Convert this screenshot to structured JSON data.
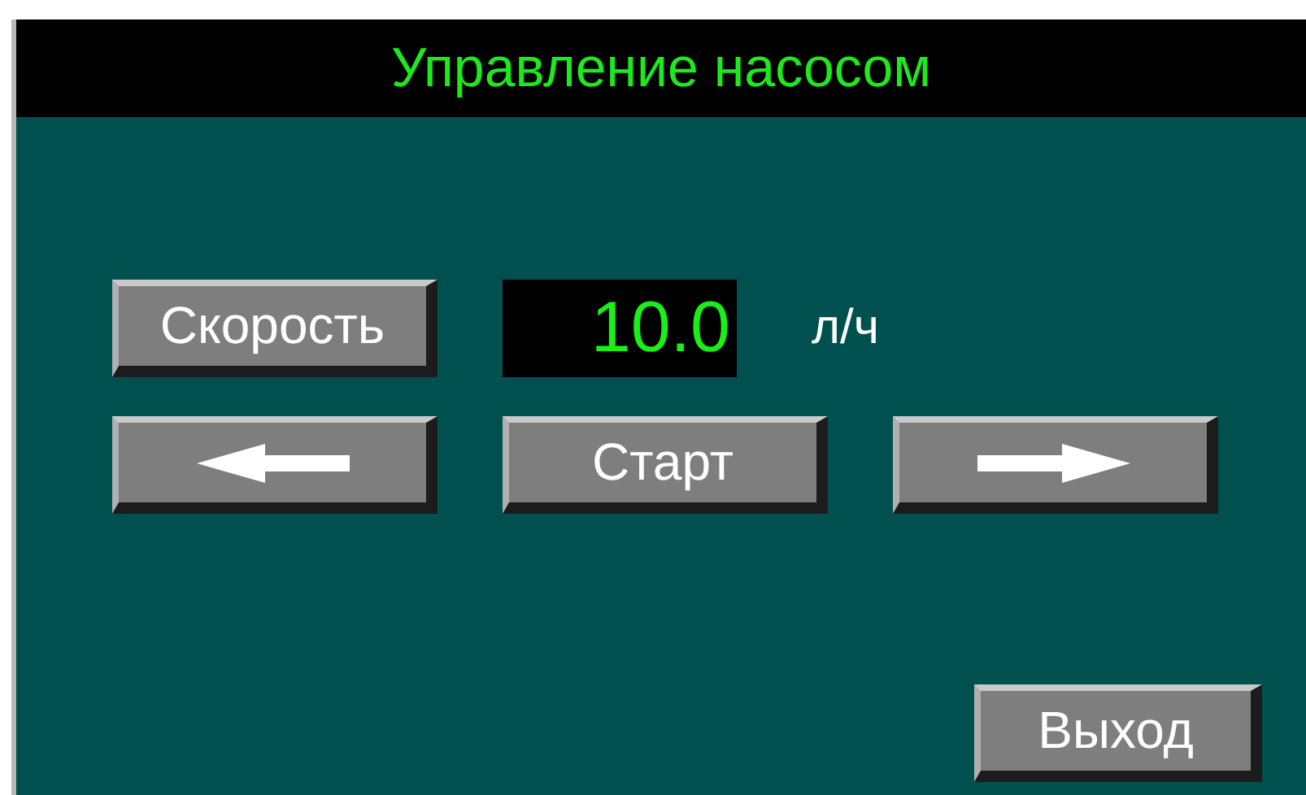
{
  "title": "Управление насосом",
  "speed": {
    "button": "Скорость",
    "value": "10.0",
    "unit": "л/ч"
  },
  "controls": [
    {
      "kind": "arrow_left"
    },
    {
      "kind": "text",
      "label": "Старт"
    },
    {
      "kind": "arrow_right"
    }
  ],
  "exit_button": "Выход"
}
